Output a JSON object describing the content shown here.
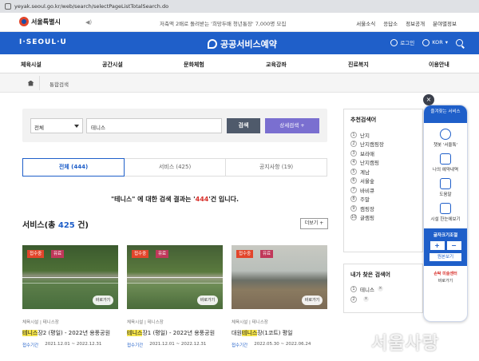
{
  "browser": {
    "url": "yeyak.seoul.go.kr/web/search/selectPageListTotalSearch.do"
  },
  "top": {
    "logo": "서울특별시",
    "notice": "저축액 2배로 돌려받는 '희망두배 청년통장' 7,000명 모집",
    "util": [
      "서울소식",
      "응답소",
      "정보공개",
      "분야별정보"
    ]
  },
  "header": {
    "iseoul": "I·SEOUL·U",
    "brand": "공공서비스예약",
    "login": "로그인",
    "lang": "KOR"
  },
  "nav": [
    "체육시설",
    "공간시설",
    "문화체험",
    "교육강좌",
    "진료복지",
    "이용안내"
  ],
  "breadcrumb": {
    "current": "통합검색"
  },
  "search": {
    "category": "전체",
    "keyword": "테니스",
    "search_label": "검색",
    "advanced_label": "상세검색 +"
  },
  "tabs": [
    {
      "label": "전체 (444)",
      "active": true
    },
    {
      "label": "서비스 (425)",
      "active": false
    },
    {
      "label": "공지사항 (19)",
      "active": false
    }
  ],
  "result": {
    "prefix": "\"테니스\" 에 대한 검색 결과는 '",
    "count": "444",
    "suffix": "'건 입니다."
  },
  "section": {
    "title_prefix": "서비스(총 ",
    "title_count": "425",
    "title_suffix": " 건)",
    "more": "더보기 +"
  },
  "cards": [
    {
      "badges": [
        "접수중",
        "유료"
      ],
      "shortcut": "바로가기",
      "category": "체육시설 | 테니스장",
      "title_hl": "테니스",
      "title_rest": "장2 (평일) - 2022년 용풍공원",
      "period_label": "접수기간",
      "period": "2021.12.01 ~ 2022.12.31"
    },
    {
      "badges": [
        "접수중",
        "유료"
      ],
      "shortcut": "바로가기",
      "category": "체육시설 | 테니스장",
      "title_hl": "테니스",
      "title_rest": "장1 (평일) - 2022년 용풍공원",
      "period_label": "접수기간",
      "period": "2021.12.01 ~ 2022.12.31"
    },
    {
      "badges": [
        "접수중",
        "유료"
      ],
      "shortcut": "바로가기",
      "category": "체육시설 | 테니스장",
      "title_pre": "대원",
      "title_hl": "테니스",
      "title_rest": "장(1코트) 평일",
      "period_label": "접수기간",
      "period": "2022.05.30 ~ 2022.06.24"
    }
  ],
  "recommend": {
    "title": "추천검색어",
    "items": [
      "난지",
      "난지캠핑장",
      "보라매",
      "난지캠핑",
      "계남",
      "서울숲",
      "바비큐",
      "주말",
      "캠핑장",
      "글램핑"
    ]
  },
  "my_search": {
    "title": "내가 찾은 검색어",
    "items": [
      "테니스",
      ""
    ]
  },
  "quick": {
    "close": "×",
    "head": "즐겨찾는 서비스",
    "items": [
      "챗봇 '서울톡'",
      "나의 예약내역",
      "도움말",
      "시설 한눈에보기"
    ],
    "font_title": "글자크기조절",
    "plus": "+",
    "minus": "−",
    "reset": "원본보기",
    "foot": "손탁 미술센터",
    "foot2": "바로가기"
  },
  "watermark": "서울사랑"
}
